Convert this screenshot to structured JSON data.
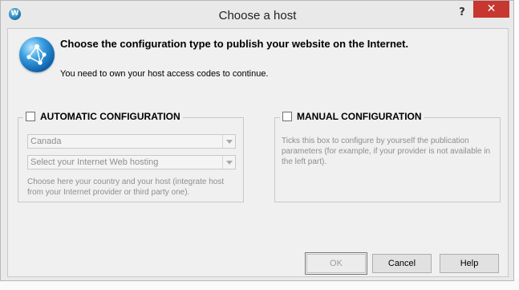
{
  "window": {
    "title": "Choose a host",
    "app_icon_letter": "W",
    "help_glyph": "?",
    "close_glyph": "✕"
  },
  "header": {
    "heading": "Choose the configuration type to publish your website on the Internet.",
    "subtext": "You need to own your host access codes to continue."
  },
  "automatic": {
    "label": "AUTOMATIC CONFIGURATION",
    "checked": false,
    "country_value": "Canada",
    "host_value": "Select your Internet Web hosting",
    "description": "Choose here your country and your host (integrate host from your Internet provider or third party one)."
  },
  "manual": {
    "label": "MANUAL CONFIGURATION",
    "checked": false,
    "description": "Ticks this box to configure by yourself the publication parameters (for example, if your provider is not available in the left part)."
  },
  "buttons": {
    "ok": "OK",
    "cancel": "Cancel",
    "help": "Help"
  },
  "colors": {
    "close_button": "#c7372f",
    "dialog_bg": "#f0f0f0",
    "disabled_text": "#8e8e8e"
  }
}
